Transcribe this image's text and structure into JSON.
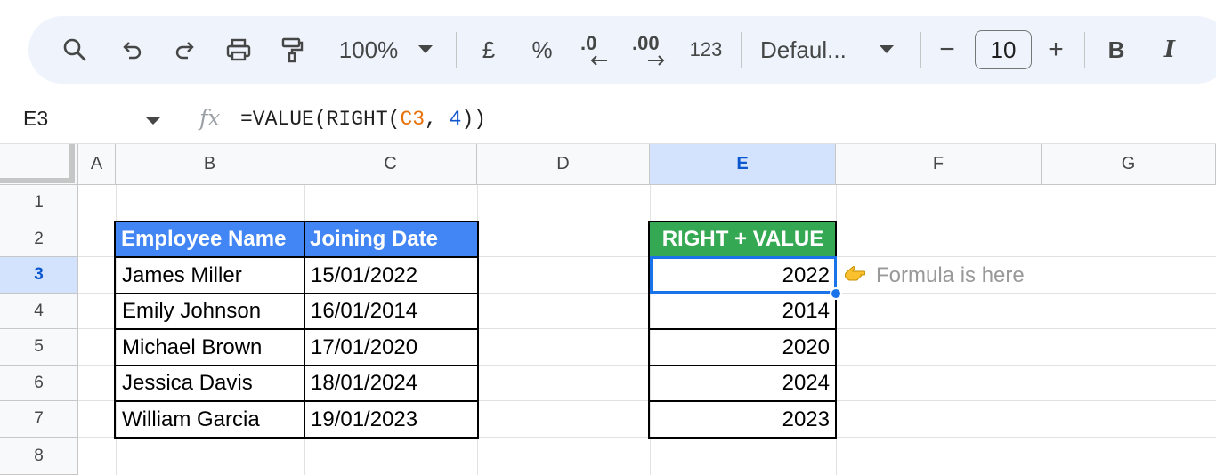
{
  "toolbar": {
    "search_icon": "search-icon",
    "undo_icon": "undo-icon",
    "redo_icon": "redo-icon",
    "print_icon": "print-icon",
    "paint_format_icon": "paint-format-icon",
    "zoom": "100%",
    "currency": "£",
    "percent": "%",
    "decrease_decimal": ".0",
    "increase_decimal": ".00",
    "number_format": "123",
    "font_family": "Defaul...",
    "decrease_font": "−",
    "font_size": "10",
    "increase_font": "+",
    "bold": "B",
    "italic": "I"
  },
  "formula_bar": {
    "name_box": "E3",
    "fx": "fx",
    "formula_prefix": "=VALUE(RIGHT(",
    "formula_ref": "C3",
    "formula_sep": ", ",
    "formula_num": "4",
    "formula_suffix": "))"
  },
  "columns": [
    "A",
    "B",
    "C",
    "D",
    "E",
    "F",
    "G"
  ],
  "rows": [
    "1",
    "2",
    "3",
    "4",
    "5",
    "6",
    "7",
    "8"
  ],
  "table": {
    "headers": [
      "Employee Name",
      "Joining Date"
    ],
    "rows": [
      [
        "James Miller",
        "15/01/2022"
      ],
      [
        "Emily Johnson",
        "16/01/2014"
      ],
      [
        "Michael Brown",
        "17/01/2020"
      ],
      [
        "Jessica Davis",
        "18/01/2024"
      ],
      [
        "William Garcia",
        "19/01/2023"
      ]
    ]
  },
  "result": {
    "header": "RIGHT + VALUE",
    "values": [
      "2022",
      "2014",
      "2020",
      "2024",
      "2023"
    ]
  },
  "note": {
    "icon": "pointing-hand-icon",
    "text": "Formula is here"
  },
  "colors": {
    "table_header": "#4285f4",
    "result_header": "#34a853",
    "selection": "#1a73e8",
    "selected_header": "#d3e3fd"
  }
}
